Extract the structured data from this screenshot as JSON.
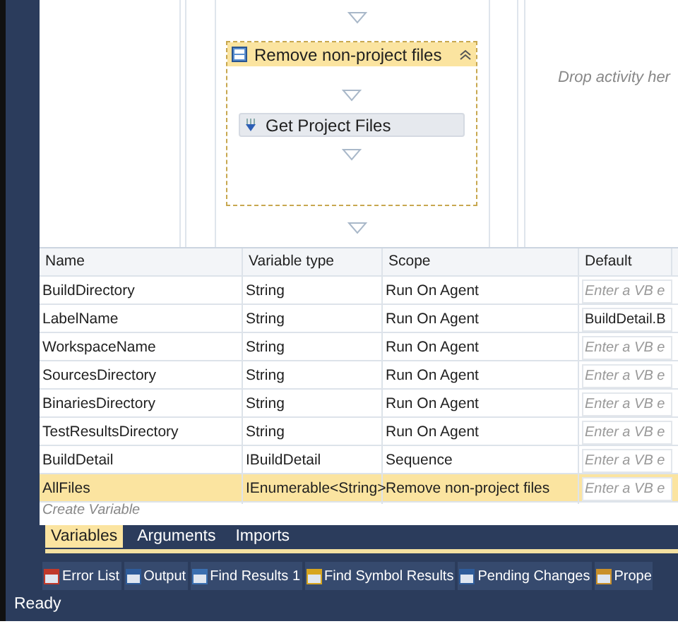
{
  "designer": {
    "sequence": {
      "title": "Remove non-project files",
      "expanded": true,
      "activities": [
        {
          "label": "Get Project Files"
        }
      ]
    },
    "drop_hint": "Drop activity her"
  },
  "variables_table": {
    "columns": [
      "Name",
      "Variable type",
      "Scope",
      "Default"
    ],
    "rows": [
      {
        "name": "BuildDirectory",
        "type": "String",
        "scope": "Run On Agent",
        "default": {
          "placeholder": "Enter a VB e"
        },
        "selected": false
      },
      {
        "name": "LabelName",
        "type": "String",
        "scope": "Run On Agent",
        "default": {
          "value": "BuildDetail.B"
        },
        "selected": false
      },
      {
        "name": "WorkspaceName",
        "type": "String",
        "scope": "Run On Agent",
        "default": {
          "placeholder": "Enter a VB e"
        },
        "selected": false
      },
      {
        "name": "SourcesDirectory",
        "type": "String",
        "scope": "Run On Agent",
        "default": {
          "placeholder": "Enter a VB e"
        },
        "selected": false
      },
      {
        "name": "BinariesDirectory",
        "type": "String",
        "scope": "Run On Agent",
        "default": {
          "placeholder": "Enter a VB e"
        },
        "selected": false
      },
      {
        "name": "TestResultsDirectory",
        "type": "String",
        "scope": "Run On Agent",
        "default": {
          "placeholder": "Enter a VB e"
        },
        "selected": false
      },
      {
        "name": "BuildDetail",
        "type": "IBuildDetail",
        "scope": "Sequence",
        "default": {
          "placeholder": "Enter a VB e"
        },
        "selected": false
      },
      {
        "name": "AllFiles",
        "type": "IEnumerable<String>",
        "scope": "Remove non-project files",
        "default": {
          "placeholder": "Enter a VB e"
        },
        "selected": true
      }
    ],
    "create_row": "Create Variable"
  },
  "designer_tabs": [
    {
      "label": "Variables",
      "selected": true
    },
    {
      "label": "Arguments",
      "selected": false
    },
    {
      "label": "Imports",
      "selected": false
    }
  ],
  "tool_windows": [
    {
      "label": "Error List"
    },
    {
      "label": "Output"
    },
    {
      "label": "Find Results 1"
    },
    {
      "label": "Find Symbol Results"
    },
    {
      "label": "Pending Changes"
    },
    {
      "label": "Prope"
    }
  ],
  "status_bar": "Ready"
}
